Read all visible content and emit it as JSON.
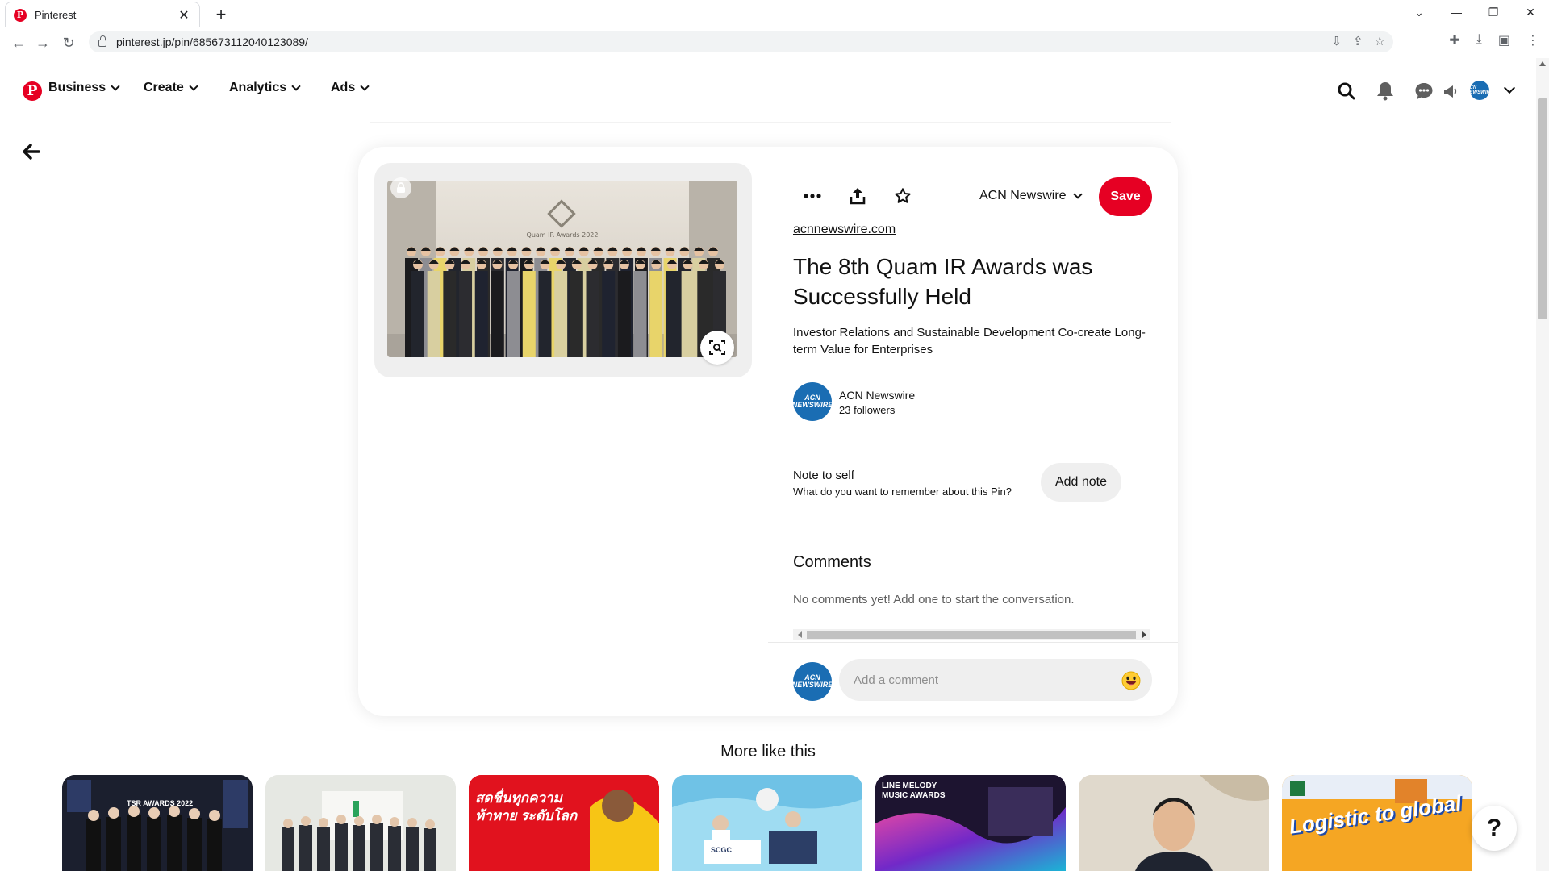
{
  "browser": {
    "tab_title": "Pinterest",
    "url": "pinterest.jp/pin/685673112040123089/"
  },
  "header": {
    "nav": [
      {
        "label": "Business"
      },
      {
        "label": "Create"
      },
      {
        "label": "Analytics"
      },
      {
        "label": "Ads"
      }
    ],
    "avatar_text": "ACN NEWSWIRE"
  },
  "pin": {
    "board_label": "ACN Newswire",
    "save_label": "Save",
    "source_link": "acnnewswire.com",
    "title": "The 8th Quam IR Awards was Successfully Held",
    "description": "Investor Relations and Sustainable Development Co-create Long-term Value for Enterprises",
    "image_banner_text": "Quam IR Awards 2022",
    "creator": {
      "avatar_text": "ACN NEWSWIRE",
      "name": "ACN Newswire",
      "followers": "23 followers"
    },
    "note": {
      "title": "Note to self",
      "subtitle": "What do you want to remember about this Pin?",
      "button": "Add note"
    },
    "comments": {
      "title": "Comments",
      "empty_text": "No comments yet! Add one to start the conversation.",
      "placeholder": "Add a comment"
    }
  },
  "more": {
    "title": "More like this",
    "thumbs": [
      {
        "text": "TSR AWARDS 2022",
        "color": "#1b1f2e"
      },
      {
        "text": "",
        "color": "#e9ece8"
      },
      {
        "text": "สดชื่นทุกความท้าทาย ระดับโลก",
        "color": "#e1121e"
      },
      {
        "text": "SCGC",
        "color": "#8fd3ee"
      },
      {
        "text": "LINE MELODY MUSIC AWARDS",
        "color": "#2a1a44"
      },
      {
        "text": "",
        "color": "#d9d2c4"
      },
      {
        "text": "Logistic to global",
        "color": "#f39a1e"
      }
    ]
  },
  "colors": {
    "brand": "#e60023",
    "avatar_blue": "#1a6db3"
  }
}
